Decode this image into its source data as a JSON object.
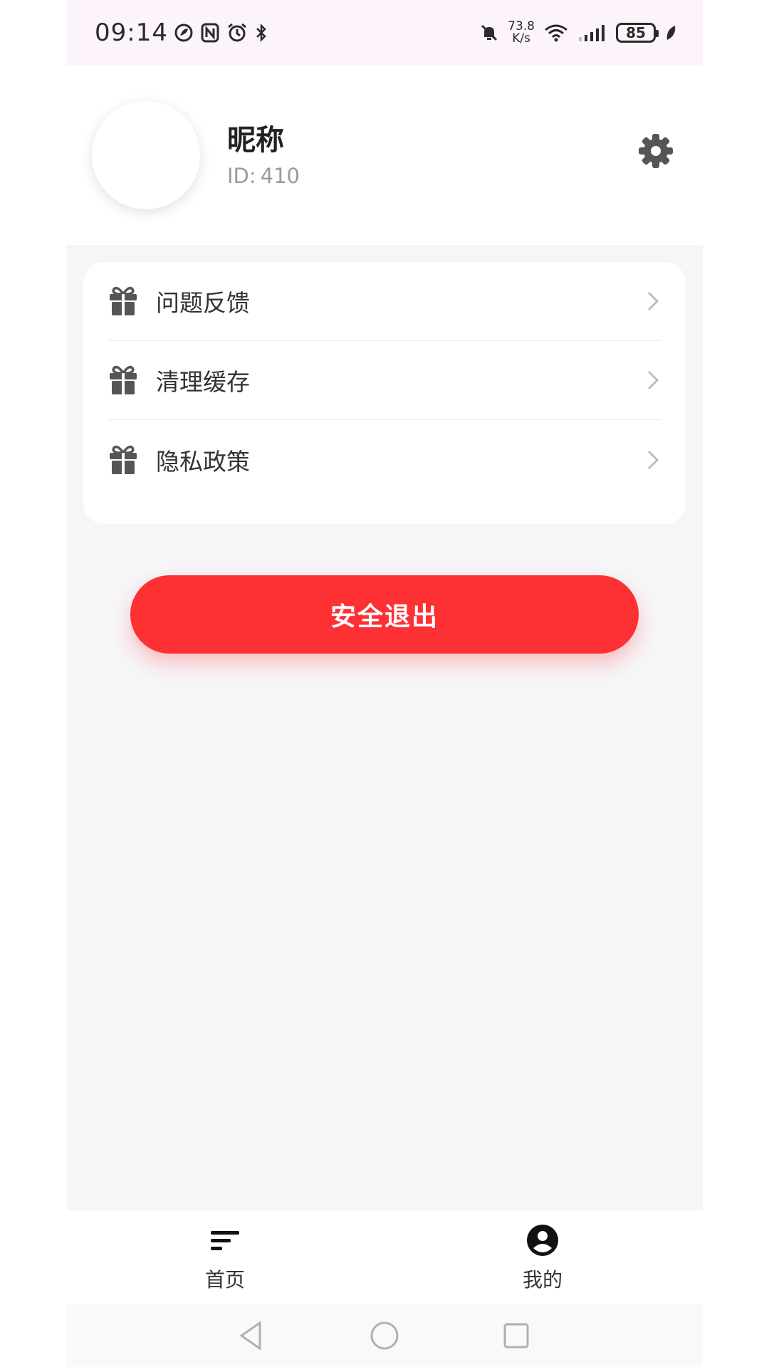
{
  "status_bar": {
    "time": "09:14",
    "net_speed_value": "73.8",
    "net_speed_unit": "K/s",
    "battery": "85"
  },
  "profile": {
    "nickname": "昵称",
    "id_label": "ID:",
    "id_value": "410"
  },
  "menu": {
    "items": [
      {
        "label": "问题反馈",
        "icon": "gift-icon"
      },
      {
        "label": "清理缓存",
        "icon": "gift-icon"
      },
      {
        "label": "隐私政策",
        "icon": "gift-icon"
      }
    ]
  },
  "logout": {
    "label": "安全退出",
    "color": "#fd3033"
  },
  "bottom_nav": {
    "items": [
      {
        "label": "首页",
        "icon": "menu-lines-icon"
      },
      {
        "label": "我的",
        "icon": "user-circle-icon"
      }
    ]
  },
  "colors": {
    "page_bg": "#f6f6f8",
    "status_bar_bg": "#fcf4fa",
    "icon_gray": "#555555"
  }
}
